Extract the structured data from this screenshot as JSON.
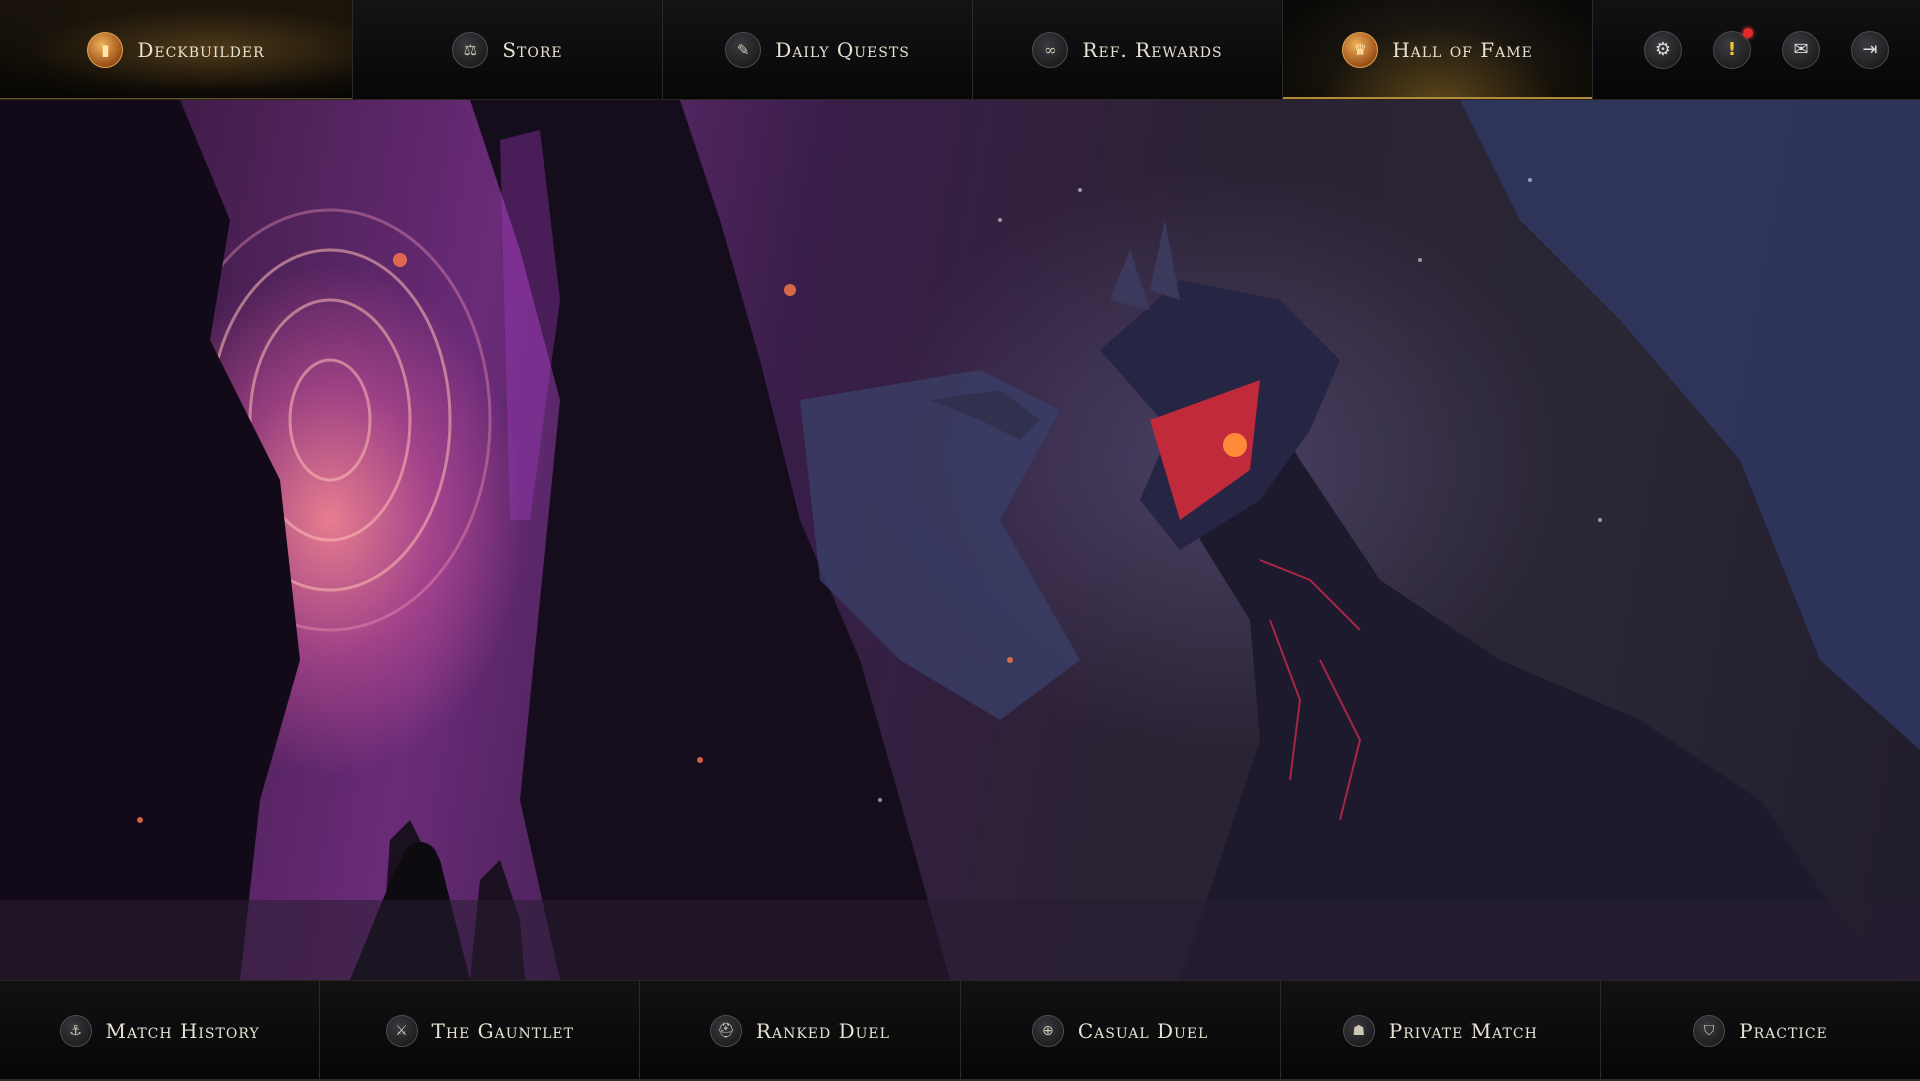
{
  "topnav": {
    "tabs": [
      {
        "label": "Deckbuilder",
        "icon": "card-icon"
      },
      {
        "label": "Store",
        "icon": "scales-icon"
      },
      {
        "label": "Daily Quests",
        "icon": "quill-icon"
      },
      {
        "label": "Ref. Rewards",
        "icon": "link-icon"
      },
      {
        "label": "Hall of Fame",
        "icon": "trophy-icon"
      }
    ],
    "active_tab": "Hall of Fame",
    "utilities": [
      {
        "name": "settings",
        "icon": "gear-icon"
      },
      {
        "name": "alerts",
        "icon": "exclamation-icon",
        "notification": true
      },
      {
        "name": "mail",
        "icon": "mail-icon"
      },
      {
        "name": "logout",
        "icon": "logout-icon"
      }
    ]
  },
  "hero": {
    "scene": "dragon-and-portal-artwork"
  },
  "modes": [
    {
      "label": "Match History",
      "icon": "history-icon"
    },
    {
      "label": "The Gauntlet",
      "icon": "crossed-swords-icon"
    },
    {
      "label": "Ranked Duel",
      "icon": "helmet-icon"
    },
    {
      "label": "Casual Duel",
      "icon": "globe-icon"
    },
    {
      "label": "Private Match",
      "icon": "hood-icon"
    },
    {
      "label": "Practice",
      "icon": "shield-icon"
    }
  ],
  "colors": {
    "accent_gold": "#b38a3a",
    "notification_red": "#e02a2a",
    "text": "#e8e2d2"
  }
}
